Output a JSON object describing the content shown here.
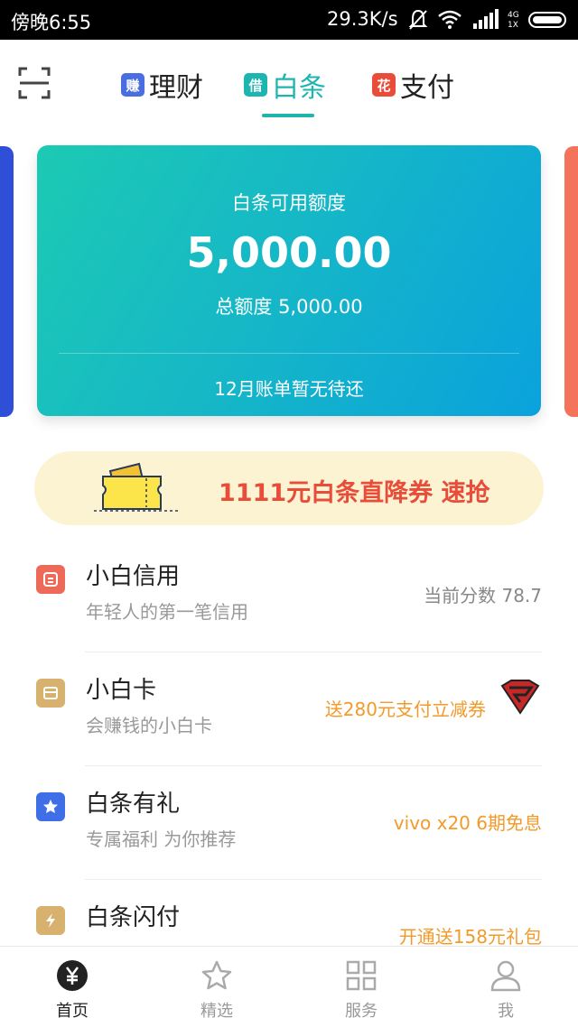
{
  "status_bar": {
    "time": "傍晚6:55",
    "speed": "29.3K/s"
  },
  "top_nav": {
    "tabs": [
      {
        "badge": "赚",
        "label": "理财",
        "badge_color": "#4a6ee0"
      },
      {
        "badge": "借",
        "label": "白条",
        "badge_color": "#1cb5b0"
      },
      {
        "badge": "花",
        "label": "支付",
        "badge_color": "#e94d3a"
      }
    ]
  },
  "card": {
    "avail_label": "白条可用额度",
    "avail_amount": "5,000.00",
    "total": "总额度 5,000.00",
    "bill": "12月账单暂无待还"
  },
  "promo": {
    "text": "1111元白条直降券 速抢"
  },
  "list": [
    {
      "title": "小白信用",
      "sub": "年轻人的第一笔信用",
      "right": "当前分数 78.7",
      "icon": "credit-icon",
      "icon_color": "#ec6a57"
    },
    {
      "title": "小白卡",
      "sub": "会赚钱的小白卡",
      "right": "送280元支付立减券",
      "icon": "card-icon",
      "icon_color": "#d8b16e"
    },
    {
      "title": "白条有礼",
      "sub": "专属福利 为你推荐",
      "right": "vivo x20 6期免息",
      "icon": "star-icon",
      "icon_color": "#3f6fe6"
    },
    {
      "title": "白条闪付",
      "sub": "",
      "right": "开通送158元礼包",
      "icon": "lightning-icon",
      "icon_color": "#d8b16e"
    }
  ],
  "bottom_nav": {
    "items": [
      {
        "label": "首页",
        "icon": "home-yen-icon"
      },
      {
        "label": "精选",
        "icon": "star-outline-icon"
      },
      {
        "label": "服务",
        "icon": "grid-icon"
      },
      {
        "label": "我",
        "icon": "user-icon"
      }
    ]
  },
  "colors": {
    "accent": "#1cb5b0",
    "promo_text": "#e94d3a",
    "orange": "#f39a2a"
  }
}
